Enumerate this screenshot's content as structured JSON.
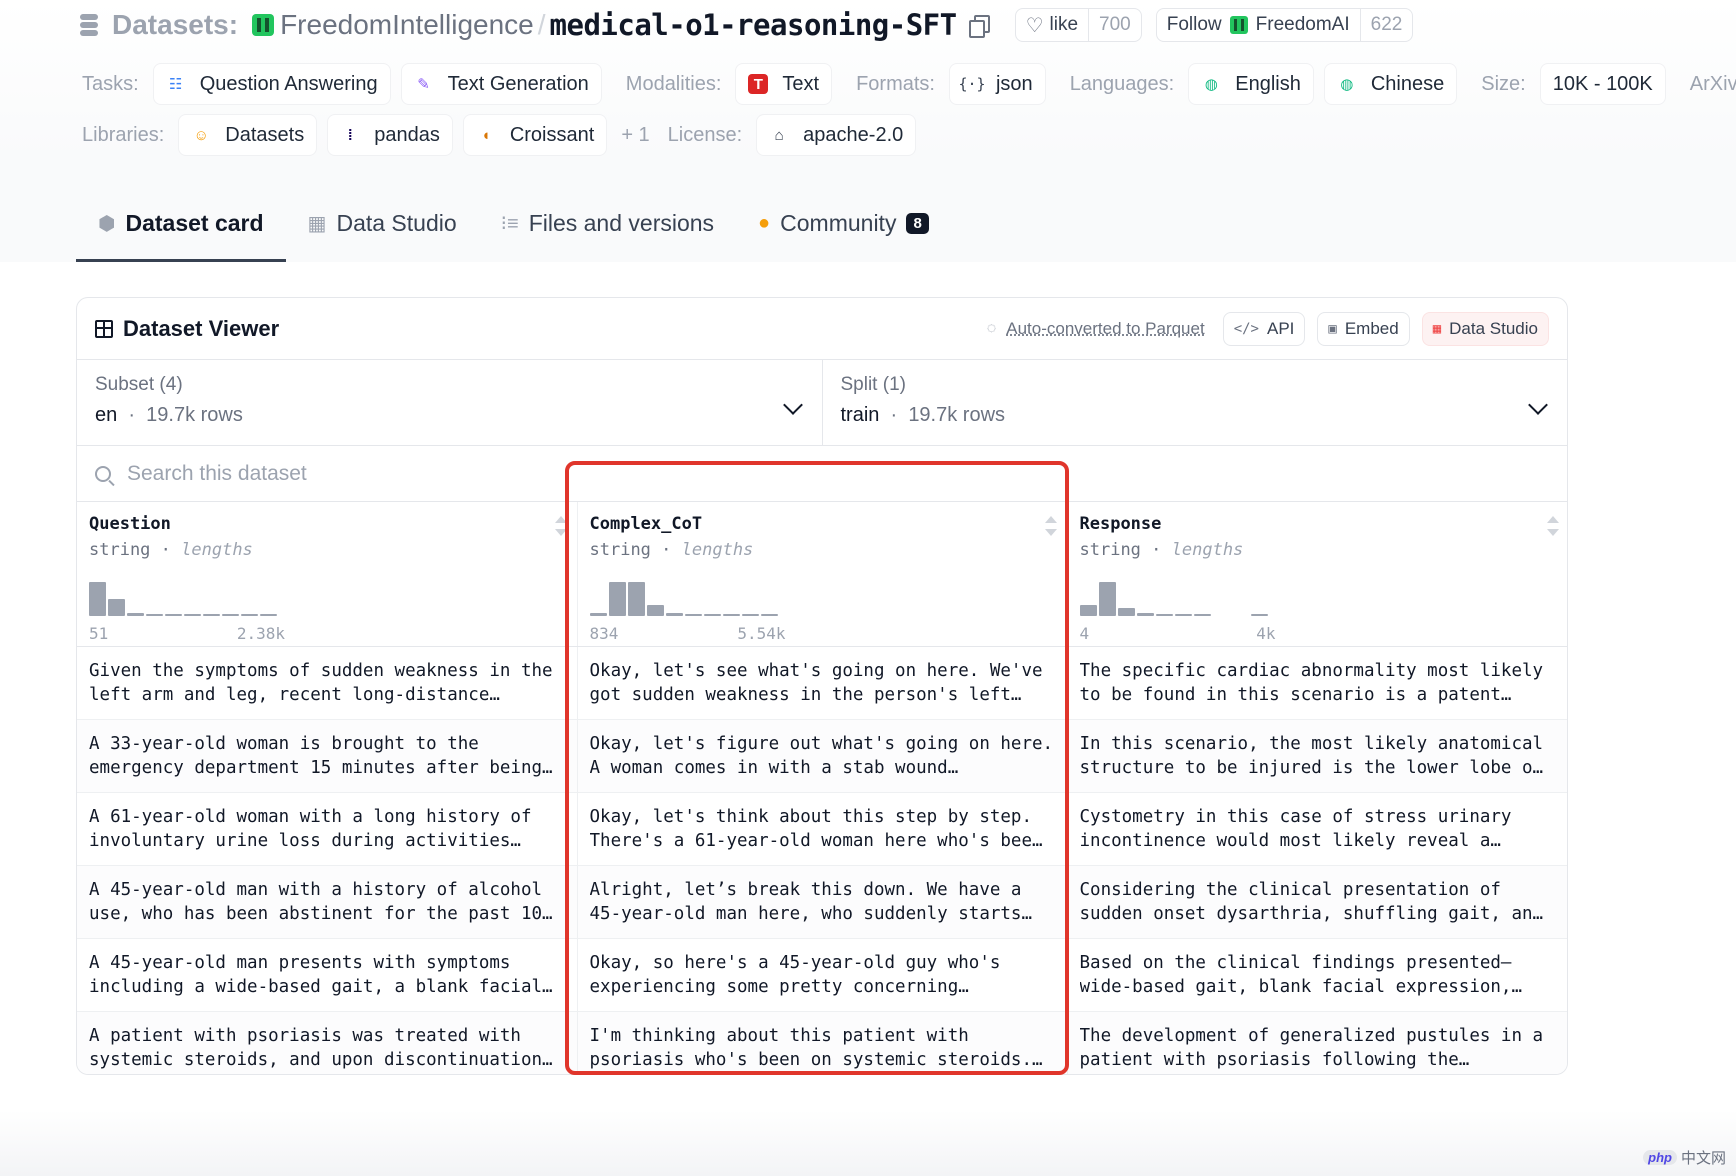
{
  "header": {
    "prefix": "Datasets:",
    "org": "FreedomIntelligence",
    "separator": "/",
    "repo": "medical-o1-reasoning-SFT",
    "like_label": "like",
    "like_count": "700",
    "follow_label": "Follow",
    "follow_org": "FreedomAI",
    "follow_count": "622"
  },
  "meta": {
    "tasks_label": "Tasks:",
    "tasks": [
      "Question Answering",
      "Text Generation"
    ],
    "modalities_label": "Modalities:",
    "modality": "Text",
    "formats_label": "Formats:",
    "format": "json",
    "languages_label": "Languages:",
    "languages": [
      "English",
      "Chinese"
    ],
    "size_label": "Size:",
    "size": "10K - 100K",
    "arxiv_label": "ArXiv:",
    "libraries_label": "Libraries:",
    "libraries": [
      "Datasets",
      "pandas",
      "Croissant"
    ],
    "libraries_more": "+ 1",
    "license_label": "License:",
    "license": "apache-2.0"
  },
  "tabs": [
    {
      "label": "Dataset card",
      "icon": "cube-icon",
      "active": true
    },
    {
      "label": "Data Studio",
      "icon": "table-icon"
    },
    {
      "label": "Files and versions",
      "icon": "files-icon"
    },
    {
      "label": "Community",
      "icon": "community-icon",
      "badge": "8"
    }
  ],
  "viewer": {
    "title": "Dataset Viewer",
    "auto_converted": "Auto-converted to Parquet",
    "api_label": "API",
    "embed_label": "Embed",
    "studio_label": "Data Studio",
    "subset": {
      "label": "Subset (4)",
      "value": "en",
      "rows": "19.7k rows"
    },
    "split": {
      "label": "Split (1)",
      "value": "train",
      "rows": "19.7k rows"
    },
    "search_placeholder": "Search this dataset",
    "columns": [
      {
        "name": "Question",
        "type": "string",
        "stat": "lengths",
        "min": "51",
        "max": "2.38k",
        "hist": [
          0.9,
          0.45,
          0.08,
          0.03,
          0.03,
          0.03,
          0.03,
          0.03,
          0.03,
          0.03
        ]
      },
      {
        "name": "Complex_CoT",
        "type": "string",
        "stat": "lengths",
        "min": "834",
        "max": "5.54k",
        "hist": [
          0.08,
          0.9,
          0.9,
          0.3,
          0.08,
          0.03,
          0.03,
          0.03,
          0.03,
          0.03
        ]
      },
      {
        "name": "Response",
        "type": "string",
        "stat": "lengths",
        "min": "4",
        "max": "4k",
        "hist": [
          0.3,
          0.9,
          0.22,
          0.08,
          0.03,
          0.03,
          0.03,
          0.0,
          0.0,
          0.03
        ]
      }
    ],
    "rows": [
      [
        "Given the symptoms of sudden weakness in the left arm and leg, recent long-distance…",
        "Okay, let's see what's going on here. We've got sudden weakness in the person's left…",
        "The specific cardiac abnormality most likely to be found in this scenario is a patent…"
      ],
      [
        "A 33-year-old woman is brought to the emergency department 15 minutes after being…",
        "Okay, let's figure out what's going on here. A woman comes in with a stab wound…",
        "In this scenario, the most likely anatomical structure to be injured is the lower lobe o…"
      ],
      [
        "A 61-year-old woman with a long history of involuntary urine loss during activities…",
        "Okay, let's think about this step by step. There's a 61-year-old woman here who's bee…",
        "Cystometry in this case of stress urinary incontinence would most likely reveal a…"
      ],
      [
        "A 45-year-old man with a history of alcohol use, who has been abstinent for the past 10…",
        "Alright, let’s break this down. We have a 45-year-old man here, who suddenly starts…",
        "Considering the clinical presentation of sudden onset dysarthria, shuffling gait, an…"
      ],
      [
        "A 45-year-old man presents with symptoms including a wide-based gait, a blank facial…",
        "Okay, so here's a 45-year-old guy who's experiencing some pretty concerning…",
        "Based on the clinical findings presented—wide-based gait, blank facial expression,…"
      ],
      [
        "A patient with psoriasis was treated with systemic steroids, and upon discontinuation…",
        "I'm thinking about this patient with psoriasis who's been on systemic steroids.…",
        "The development of generalized pustules in a patient with psoriasis following the…"
      ]
    ]
  },
  "highlight_color": "#e0352b",
  "watermark": {
    "badge": "php",
    "text": "中文网"
  }
}
